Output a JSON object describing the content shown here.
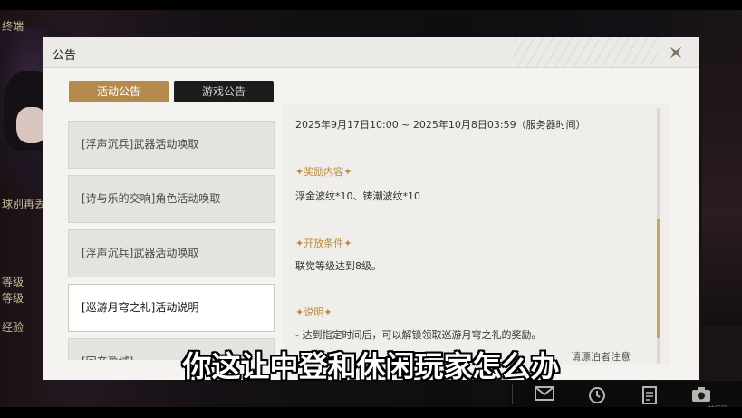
{
  "background": {
    "left_labels": [
      "终端",
      "球别再丢",
      "等级",
      "等级",
      "经验"
    ]
  },
  "modal": {
    "title": "公告",
    "close_icon": "close-star-icon"
  },
  "tabs": [
    {
      "label": "活动公告",
      "active": true
    },
    {
      "label": "游戏公告",
      "active": false
    }
  ],
  "announcements": [
    {
      "label": "[浮声沉兵]武器活动唤取",
      "selected": false
    },
    {
      "label": "[诗与乐的交响]角色活动唤取",
      "selected": false
    },
    {
      "label": "[浮声沉兵]武器活动唤取",
      "selected": false
    },
    {
      "label": "[巡游月穹之礼]活动说明",
      "selected": true
    },
    {
      "label": "[回音盈域]",
      "selected": false
    }
  ],
  "content": {
    "time_range": "2025年9月17日10:00 ~ 2025年10月8日03:59（服务器时间）",
    "reward_heading": "✦奖励内容✦",
    "reward_text": "浮金波纹*10、铸潮波纹*10",
    "condition_heading": "✦开放条件✦",
    "condition_text": "联觉等级达到8级。",
    "note_heading": "✦说明✦",
    "note_text": "- 达到指定时间后，可以解锁领取巡游月穹之礼的奖励。",
    "note_text_partial": "请漂泊者注意"
  },
  "bottom_bar": {
    "icons": [
      "mail-icon",
      "clock-icon",
      "notes-icon",
      "camera-icon"
    ],
    "label": "特征码"
  },
  "subtitle": "你这让中登和休闲玩家怎么办",
  "colors": {
    "accent_gold": "#b58a4d",
    "heading_gold": "#b8893e",
    "modal_bg": "#f4f3f0"
  }
}
